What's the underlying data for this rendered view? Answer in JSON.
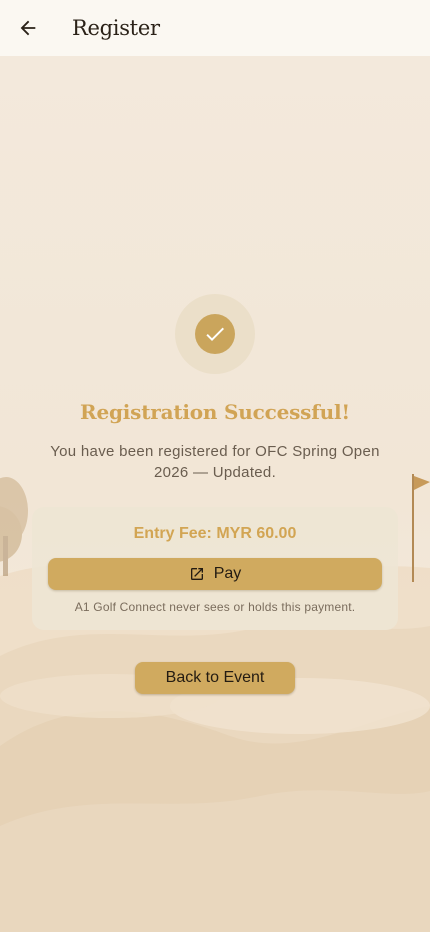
{
  "app_bar": {
    "title": "Register",
    "back_icon": "arrow-left-icon"
  },
  "success": {
    "icon": "check-circle-icon",
    "title": "Registration Successful!",
    "message": "You have been registered for OFC Spring Open 2026 — Updated."
  },
  "payment": {
    "fee_label": "Entry Fee: MYR 60.00",
    "pay_label": "Pay",
    "pay_icon": "external-link-icon",
    "note": "A1 Golf Connect never sees or holds this payment."
  },
  "actions": {
    "back_to_event_label": "Back to Event"
  },
  "colors": {
    "accent": "#d0aa5f",
    "title_gold": "#d1a455",
    "background": "#f4ece0"
  }
}
